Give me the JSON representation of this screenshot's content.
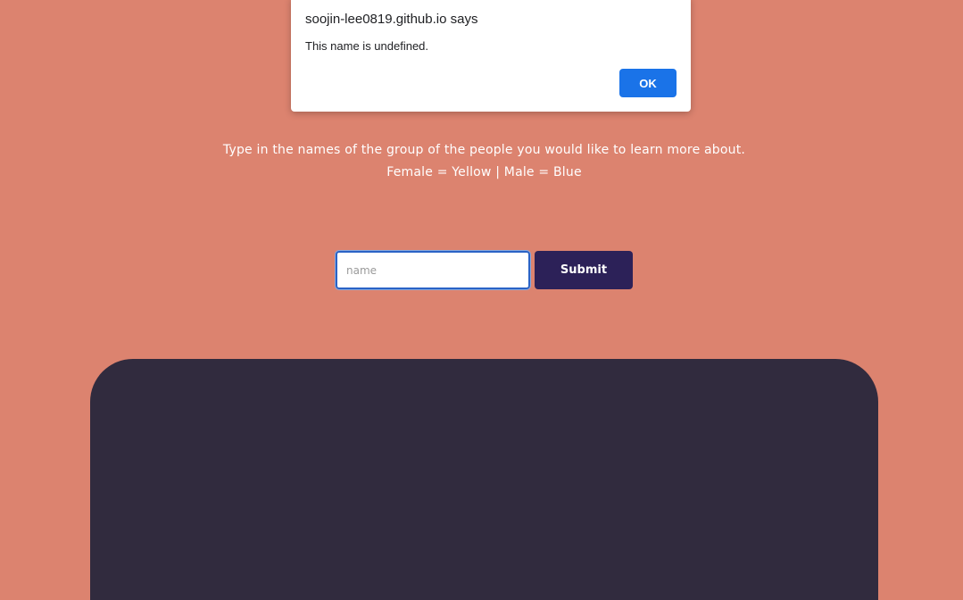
{
  "alert": {
    "title": "soojin-lee0819.github.io says",
    "message": "This name is undefined.",
    "ok_label": "OK"
  },
  "instructions": {
    "line1": "Type in the names of the group of the people you would like to learn more about.",
    "line2": "Female = Yellow | Male = Blue"
  },
  "form": {
    "name_placeholder": "name",
    "name_value": "",
    "submit_label": "Submit"
  },
  "colors": {
    "background": "#dc836f",
    "panel": "#312b3e",
    "submit_button": "#2c2158",
    "alert_ok": "#1a73e8"
  }
}
